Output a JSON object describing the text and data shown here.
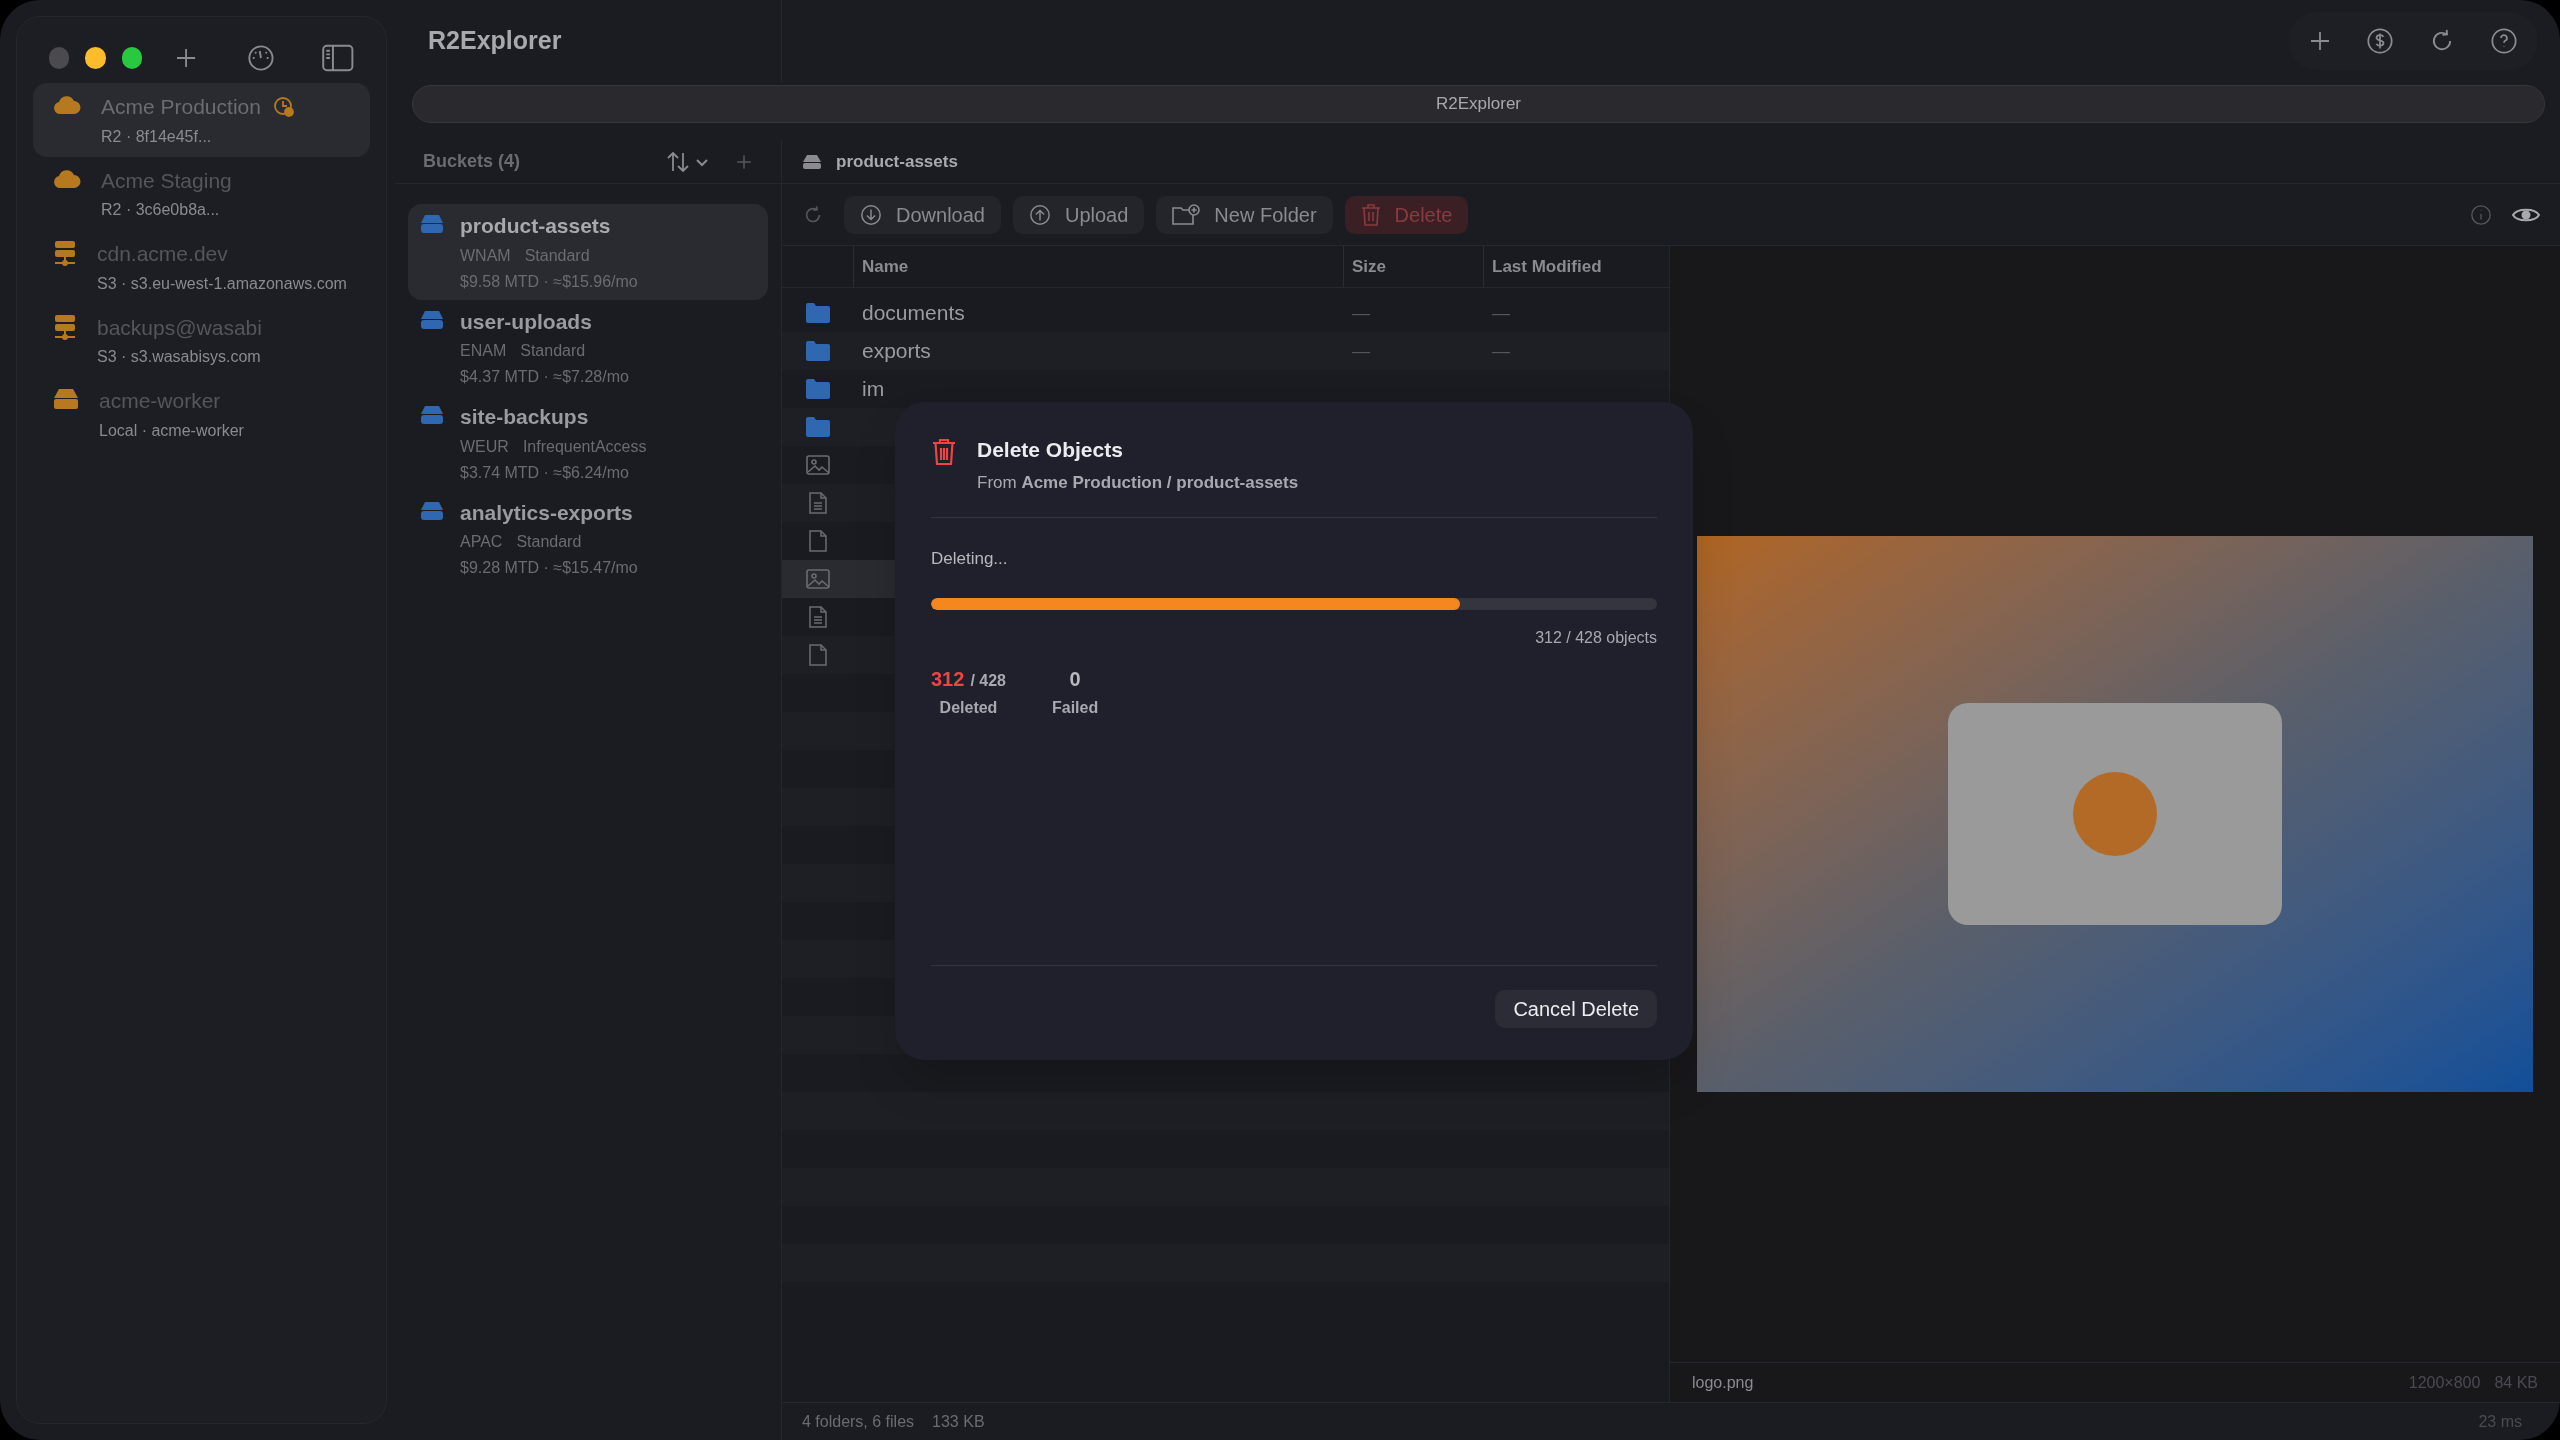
{
  "window": {
    "title": "R2Explorer"
  },
  "sidebar": {
    "accounts": [
      {
        "name": "Acme Production",
        "detail": "R2 · 8f14e45f...",
        "kind": "r2",
        "selected": true,
        "status_badge": true
      },
      {
        "name": "Acme Staging",
        "detail": "R2 · 3c6e0b8a...",
        "kind": "r2",
        "selected": false,
        "status_badge": false
      },
      {
        "name": "cdn.acme.dev",
        "detail": "S3 · s3.eu-west-1.amazonaws.com",
        "kind": "s3",
        "selected": false,
        "status_badge": false
      },
      {
        "name": "backups@wasabi",
        "detail": "S3 · s3.wasabisys.com",
        "kind": "s3",
        "selected": false,
        "status_badge": false
      },
      {
        "name": "acme-worker",
        "detail": "Local · acme-worker",
        "kind": "local",
        "selected": false,
        "status_badge": false
      }
    ]
  },
  "address_bar": {
    "text": "R2Explorer"
  },
  "buckets": {
    "title": "Buckets (4)",
    "items": [
      {
        "name": "product-assets",
        "region": "WNAM",
        "storage_class": "Standard",
        "cost": "$9.58 MTD · ≈$15.96/mo",
        "selected": true
      },
      {
        "name": "user-uploads",
        "region": "ENAM",
        "storage_class": "Standard",
        "cost": "$4.37 MTD · ≈$7.28/mo",
        "selected": false
      },
      {
        "name": "site-backups",
        "region": "WEUR",
        "storage_class": "InfrequentAccess",
        "cost": "$3.74 MTD · ≈$6.24/mo",
        "selected": false
      },
      {
        "name": "analytics-exports",
        "region": "APAC",
        "storage_class": "Standard",
        "cost": "$9.28 MTD · ≈$15.47/mo",
        "selected": false
      }
    ]
  },
  "breadcrumb": "product-assets",
  "toolbar": {
    "buttons": [
      {
        "label": "Download",
        "kind": "download"
      },
      {
        "label": "Upload",
        "kind": "upload"
      },
      {
        "label": "New Folder",
        "kind": "new_folder"
      },
      {
        "label": "Delete",
        "kind": "delete"
      }
    ]
  },
  "table": {
    "columns": [
      "Name",
      "Size",
      "Last Modified"
    ],
    "rows": [
      {
        "kind": "folder",
        "name": "documents",
        "size": "—",
        "modified": "—",
        "selected": false
      },
      {
        "kind": "folder",
        "name": "exports",
        "size": "—",
        "modified": "—",
        "selected": false
      },
      {
        "kind": "folder",
        "name": "im",
        "selected": false
      },
      {
        "kind": "folder",
        "selected": false
      },
      {
        "kind": "image",
        "selected": false
      },
      {
        "kind": "document",
        "selected": false
      },
      {
        "kind": "file",
        "selected": false
      },
      {
        "kind": "image",
        "selected": true
      },
      {
        "kind": "document",
        "selected": false
      },
      {
        "kind": "file",
        "selected": false
      }
    ]
  },
  "preview": {
    "file_name": "logo.png",
    "dimensions": "1200×800",
    "size": "84 KB"
  },
  "status_bar": {
    "counts": "4 folders, 6 files",
    "total_size": "133 KB",
    "timing": "23 ms"
  },
  "dialog": {
    "title": "Delete Objects",
    "subtitle": "From **Acme Production / product-assets**",
    "status": "Deleting...",
    "progress": {
      "level": 0.729
    },
    "progress_text": "312 / 428 objects",
    "stats": [
      {
        "kind": "deleted",
        "value": "312",
        "total": "/ 428",
        "label": "Deleted"
      },
      {
        "kind": "failed",
        "value": "0",
        "label": "Failed"
      }
    ],
    "cancel_button": "Cancel Delete"
  }
}
